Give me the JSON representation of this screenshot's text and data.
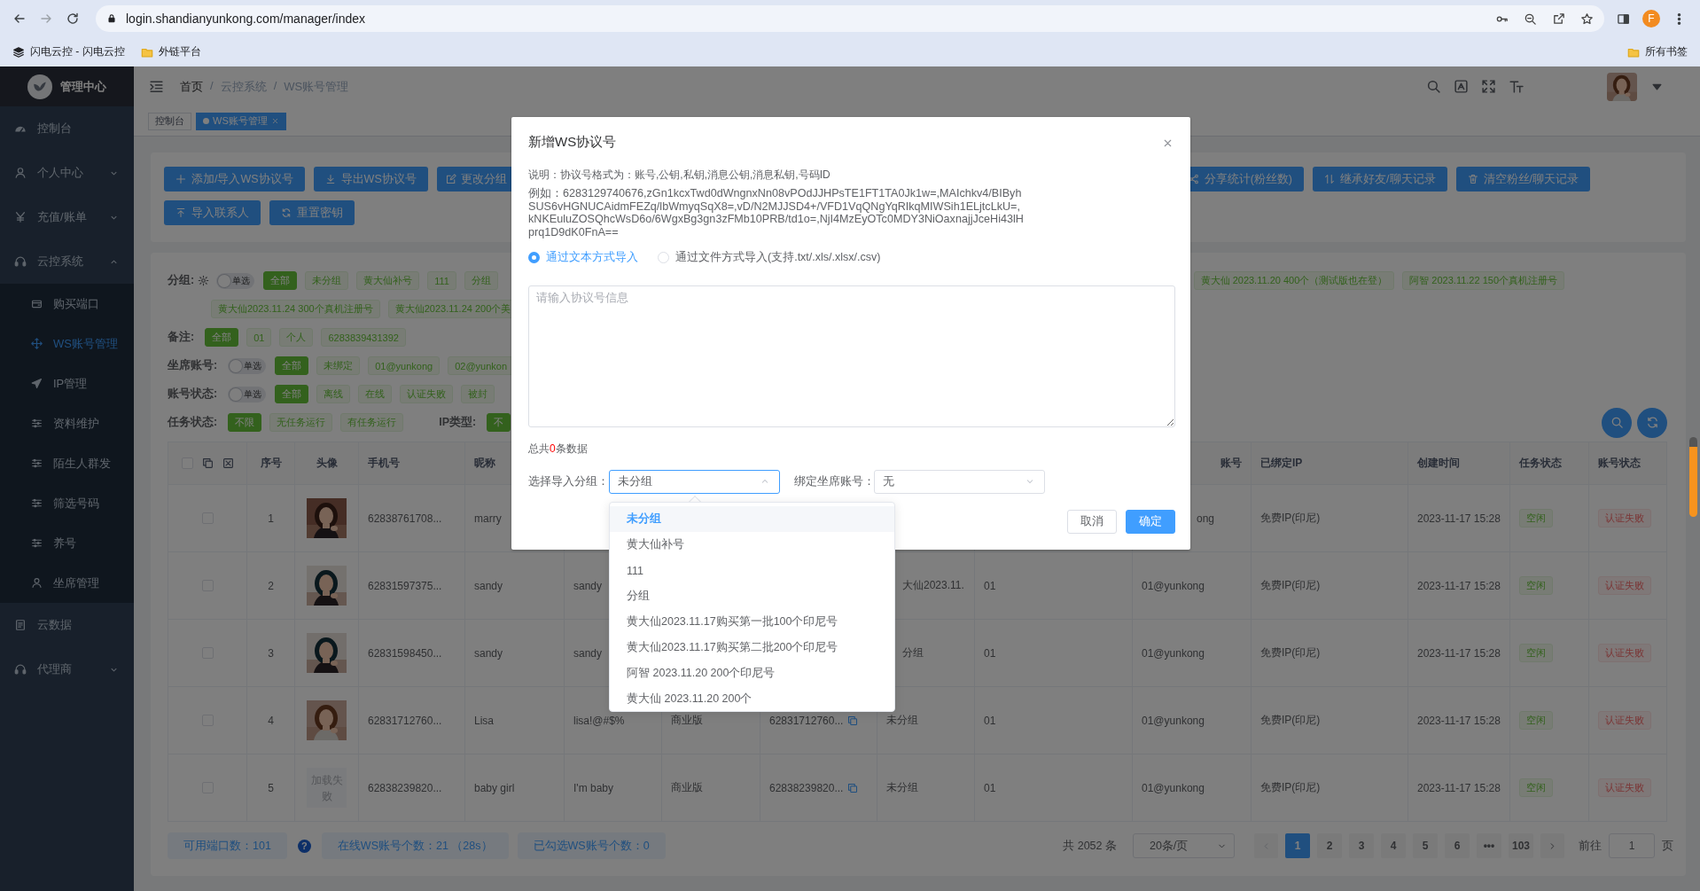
{
  "browser": {
    "url": "login.shandianyunkong.com/manager/index",
    "profile_initial": "F",
    "bookmarks": [
      {
        "label": "闪电云控 - 闪电云控",
        "kind": "site"
      },
      {
        "label": "外链平台",
        "kind": "folder"
      }
    ],
    "all_bookmarks": "所有书签"
  },
  "sidebar": {
    "title": "管理中心",
    "items": [
      {
        "label": "控制台"
      },
      {
        "label": "个人中心",
        "expanded": false
      },
      {
        "label": "充值/账单",
        "expanded": false
      },
      {
        "label": "云控系统",
        "expanded": true,
        "children": [
          {
            "label": "购买端口",
            "selected": false
          },
          {
            "label": "WS账号管理",
            "selected": true
          },
          {
            "label": "IP管理",
            "selected": false
          },
          {
            "label": "资料维护",
            "selected": false
          },
          {
            "label": "陌生人群发",
            "selected": false
          },
          {
            "label": "筛选号码",
            "selected": false
          },
          {
            "label": "养号",
            "selected": false
          },
          {
            "label": "坐席管理",
            "selected": false
          }
        ]
      },
      {
        "label": "云数据"
      },
      {
        "label": "代理商",
        "expanded": false
      }
    ]
  },
  "breadcrumb": {
    "separator": "/",
    "items": [
      "首页",
      "云控系统",
      "WS账号管理"
    ]
  },
  "view_tabs": [
    {
      "label": "控制台",
      "selected": false
    },
    {
      "label": "WS账号管理",
      "selected": true
    }
  ],
  "toolbar": {
    "buttons_row_1": [
      "添加/导入WS协议号",
      "导出WS协议号",
      "更改分组",
      "分享统计(粉丝数)",
      "继承好友/聊天记录",
      "清空粉丝/聊天记录"
    ],
    "buttons_row_2": [
      "导入联系人",
      "重置密钥"
    ]
  },
  "filters": [
    {
      "label": "分组:",
      "toggle_label": "单选",
      "single_select": false,
      "tags": [
        {
          "label": "全部",
          "selected": true
        },
        {
          "label": "未分组",
          "selected": false
        },
        {
          "label": "黄大仙补号",
          "selected": false
        },
        {
          "label": "111",
          "selected": false
        },
        {
          "label": "分组",
          "selected": false
        },
        {
          "label": "黄大仙 2023.11.20 400个（测试版也在登）",
          "selected": false
        },
        {
          "label": "阿智 2023.11.22 150个真机注册号",
          "selected": false
        },
        {
          "label": "黄大仙2023.11.24 300个真机注册号",
          "selected": false
        },
        {
          "label": "黄大仙2023.11.24 200个美",
          "selected": false
        }
      ]
    },
    {
      "label": "备注:",
      "tags": [
        {
          "label": "全部",
          "selected": true
        },
        {
          "label": "01",
          "selected": false
        },
        {
          "label": "个人",
          "selected": false
        },
        {
          "label": "6283839431392",
          "selected": false
        }
      ]
    },
    {
      "label": "坐席账号:",
      "toggle_label": "单选",
      "single_select": false,
      "tags": [
        {
          "label": "全部",
          "selected": true
        },
        {
          "label": "未绑定",
          "selected": false
        },
        {
          "label": "01@yunkong",
          "selected": false
        },
        {
          "label": "02@yunkon",
          "selected": false
        }
      ]
    },
    {
      "label": "账号状态:",
      "toggle_label": "单选",
      "single_select": false,
      "tags": [
        {
          "label": "全部",
          "selected": true
        },
        {
          "label": "离线",
          "selected": false
        },
        {
          "label": "在线",
          "selected": false
        },
        {
          "label": "认证失败",
          "selected": false
        },
        {
          "label": "被封",
          "selected": false
        }
      ]
    },
    {
      "label": "任务状态:",
      "tags": [
        {
          "label": "不限",
          "selected": true
        },
        {
          "label": "无任务运行",
          "selected": false
        },
        {
          "label": "有任务运行",
          "selected": false
        }
      ],
      "extra": {
        "label": "IP类型:",
        "tags": [
          {
            "label": "不",
            "selected": true
          }
        ]
      }
    }
  ],
  "table": {
    "select_all_checked": false,
    "columns": [
      "序号",
      "头像",
      "手机号",
      "昵称",
      "账号",
      "已绑定IP",
      "创建时间",
      "任务状态",
      "账号状态"
    ],
    "rows": [
      {
        "checked": false,
        "index": "1",
        "phone": "62838761708...",
        "nickname": "marry",
        "seat_account": "ong",
        "ip": "免费IP(印尼)",
        "created": "2023-11-17 15:28",
        "task_status": "空闲",
        "account_status": "认证失败"
      },
      {
        "checked": false,
        "index": "2",
        "phone": "62831597375...",
        "nickname": "sandy",
        "column_6": "sandy",
        "column_9": "大仙2023.11.",
        "column_10": "01",
        "seat_account": "01@yunkong",
        "ip": "免费IP(印尼)",
        "created": "2023-11-17 15:28",
        "task_status": "空闲",
        "account_status": "认证失败"
      },
      {
        "checked": false,
        "index": "3",
        "phone": "62831598450...",
        "nickname": "sandy",
        "column_6": "sandy",
        "column_9": "分组",
        "column_10": "01",
        "seat_account": "01@yunkong",
        "ip": "免费IP(印尼)",
        "created": "2023-11-17 15:28",
        "task_status": "空闲",
        "account_status": "认证失败"
      },
      {
        "checked": false,
        "index": "4",
        "phone": "62831712760...",
        "nickname": "Lisa",
        "column_6": "lisa!@#$%",
        "column_7": "商业版",
        "column_8": "62831712760...",
        "column_9": "未分组",
        "column_10": "01",
        "seat_account": "01@yunkong",
        "ip": "免费IP(印尼)",
        "created": "2023-11-17 15:28",
        "task_status": "空闲",
        "account_status": "认证失败"
      },
      {
        "checked": false,
        "index": "5",
        "avatar": {
          "kind": "text",
          "text": "加载失败"
        },
        "phone": "62838239820...",
        "nickname": "baby girl",
        "column_6": "I'm baby",
        "column_7": "商业版",
        "column_8": "62838239820...",
        "column_9": "未分组",
        "column_10": "01",
        "seat_account": "01@yunkong",
        "ip": "免费IP(印尼)",
        "created": "2023-11-17 15:28",
        "task_status": "空闲",
        "account_status": "认证失败"
      }
    ]
  },
  "stats": [
    {
      "label": "可用端口数：101"
    },
    {
      "label": "在线WS账号个数：21 （28s）"
    },
    {
      "label": "已勾选WS账号个数：0"
    }
  ],
  "help": "?",
  "pagination": {
    "total": "共 2052 条",
    "page_size": "20条/页",
    "pages": [
      {
        "label": "1",
        "selected": true
      },
      {
        "label": "2",
        "selected": false
      },
      {
        "label": "3",
        "selected": false
      },
      {
        "label": "4",
        "selected": false
      },
      {
        "label": "5",
        "selected": false
      },
      {
        "label": "6",
        "selected": false
      },
      {
        "label": "•••",
        "selected": false
      },
      {
        "label": "103",
        "selected": false
      }
    ],
    "goto_label": "前往",
    "goto_value": "1",
    "page_suffix": "页"
  },
  "dialog": {
    "title": "新增WS协议号",
    "note": "说明：协议号格式为：账号,公钥,私钥,消息公钥,消息私钥,号码ID",
    "example": "例如：6283129740676,zGn1kcxTwd0dWngnxNn08vPOdJJHPsTE1FT1TA0Jk1w=,MAIchkv4/BIByhSUS6vHGNUCAidmFEZq/lbWmyqSqX8=,vD/N2MJJSD4+/VFD1VqQNgYqRIkqMIWSih1ELjtcLkU=,kNKEuluZOSQhcWsD6o/6WgxBg3gn3zFMb10PRB/td1o=,NjI4MzEyOTc0MDY3NiOaxnajjJceHi43lHprq1D9dK0FnA==",
    "import_modes": [
      {
        "label": "通过文本方式导入",
        "selected": true
      },
      {
        "label": "通过文件方式导入(支持.txt/.xls/.xlsx/.csv)",
        "selected": false
      }
    ],
    "textarea": {
      "placeholder": "请输入协议号信息"
    },
    "total": {
      "before": "总共",
      "count": "0",
      "after": "条数据"
    },
    "group_select": {
      "label": "选择导入分组：",
      "value": "未分组",
      "expanded": true,
      "options": [
        {
          "label": "未分组",
          "selected": true
        },
        {
          "label": "黄大仙补号",
          "selected": false
        },
        {
          "label": "111",
          "selected": false
        },
        {
          "label": "分组",
          "selected": false
        },
        {
          "label": "黄大仙2023.11.17购买第一批100个印尼号",
          "selected": false
        },
        {
          "label": "黄大仙2023.11.17购买第二批200个印尼号",
          "selected": false
        },
        {
          "label": "阿智 2023.11.20 200个印尼号",
          "selected": false
        },
        {
          "label": "黄大仙 2023.11.20 200个",
          "selected": false
        }
      ]
    },
    "seat_select": {
      "label": "绑定坐席账号：",
      "value": "无",
      "expanded": false
    },
    "buttons": [
      {
        "label": "取消",
        "kind": "secondary"
      },
      {
        "label": "确定",
        "kind": "primary"
      }
    ]
  }
}
